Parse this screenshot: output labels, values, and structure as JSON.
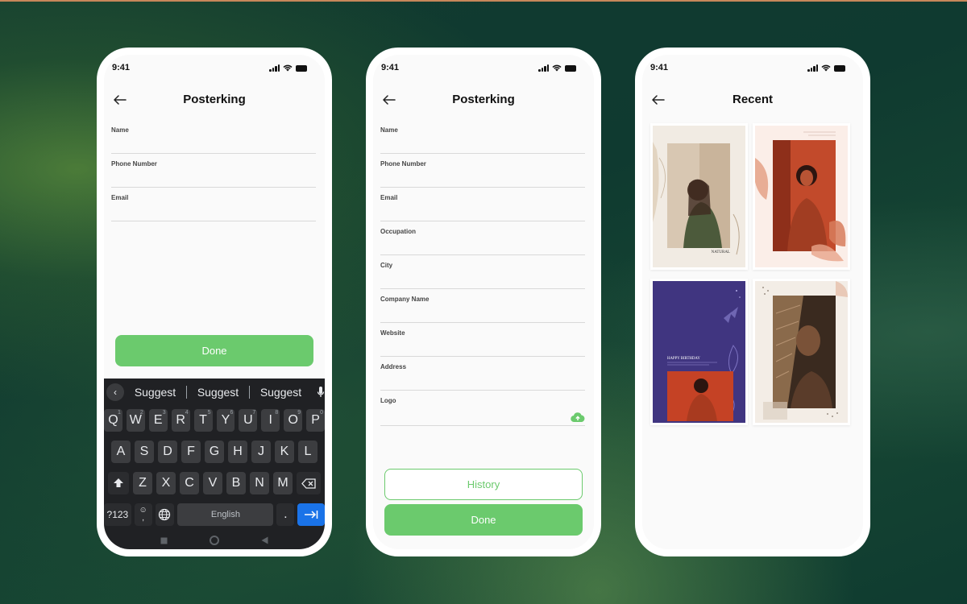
{
  "phones": [
    {
      "status_time": "9:41",
      "title": "Posterking",
      "fields": [
        "Name",
        "Phone Number",
        "Email"
      ],
      "done_label": "Done",
      "keyboard": {
        "suggestions": [
          "Suggest",
          "Suggest",
          "Suggest"
        ],
        "row1": [
          "Q",
          "W",
          "E",
          "R",
          "T",
          "Y",
          "U",
          "I",
          "O",
          "P"
        ],
        "row1_hints": [
          "1",
          "2",
          "3",
          "4",
          "5",
          "6",
          "7",
          "8",
          "9",
          "0"
        ],
        "row2": [
          "A",
          "S",
          "D",
          "F",
          "G",
          "H",
          "J",
          "K",
          "L"
        ],
        "row3": [
          "Z",
          "X",
          "C",
          "V",
          "B",
          "N",
          "M"
        ],
        "symbols_label": "?123",
        "emoji_hint": "☺",
        "comma_label": ",",
        "space_label": "English",
        "period_label": "."
      }
    },
    {
      "status_time": "9:41",
      "title": "Posterking",
      "fields": [
        "Name",
        "Phone Number",
        "Email",
        "Occupation",
        "City",
        "Company Name",
        "Website",
        "Address",
        "Logo"
      ],
      "history_label": "History",
      "done_label": "Done"
    },
    {
      "status_time": "9:41",
      "title": "Recent",
      "posters": [
        {
          "name": "natural-poster",
          "text": "NATURAL"
        },
        {
          "name": "portrait-poster",
          "text": ""
        },
        {
          "name": "birthday-poster",
          "text": "HAPPY BIRTHDAY"
        },
        {
          "name": "shadow-poster",
          "text": ""
        }
      ]
    }
  ],
  "colors": {
    "accent": "#6bca6d",
    "keyboard_bg": "#202124",
    "key_bg": "#3c3d40",
    "enter_key": "#1a73e8"
  },
  "icons": [
    "back-arrow-icon",
    "cellular-signal-icon",
    "wifi-icon",
    "battery-icon",
    "microphone-icon",
    "cloud-upload-icon",
    "shift-icon",
    "backspace-icon",
    "globe-icon",
    "tab-enter-icon"
  ]
}
